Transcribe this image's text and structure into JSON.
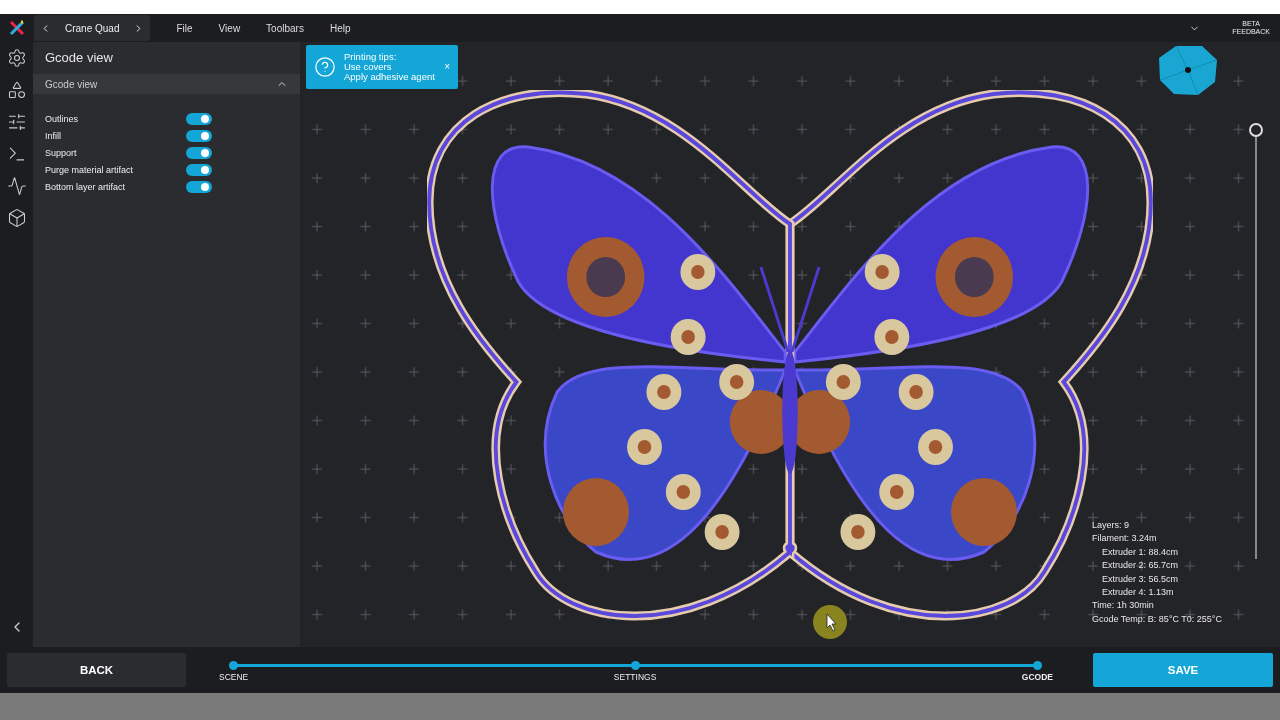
{
  "menubar": {
    "printer": "Crane Quad",
    "menus": [
      "File",
      "View",
      "Toolbars",
      "Help"
    ],
    "beta": "BETA",
    "feedback": "FEEDBACK"
  },
  "panel": {
    "title": "Gcode view",
    "section": {
      "title": "Gcode view",
      "expanded": true,
      "toggles": [
        {
          "label": "Outlines",
          "on": true
        },
        {
          "label": "Infill",
          "on": true
        },
        {
          "label": "Support",
          "on": true
        },
        {
          "label": "Purge material artifact",
          "on": true
        },
        {
          "label": "Bottom layer artifact",
          "on": true
        }
      ]
    }
  },
  "tip": {
    "title": "Printing tips:",
    "lines": [
      "Use covers",
      "Apply adhesive agent"
    ],
    "close": "×"
  },
  "layer_slider": {
    "level": 1
  },
  "stats": [
    {
      "text": "Layers: 9"
    },
    {
      "text": "Filament: 3.24m",
      "children": [
        {
          "text": "Extruder 1: 88.4cm"
        },
        {
          "text": "Extruder 2: 65.7cm"
        },
        {
          "text": "Extruder 3: 56.5cm"
        },
        {
          "text": "Extruder 4: 1.13m"
        }
      ]
    },
    {
      "text": "Time: 1h 30min"
    },
    {
      "text": "Gcode Temp: B: 85°C T0: 255°C"
    }
  ],
  "footer": {
    "back": "BACK",
    "save": "SAVE",
    "steps": [
      {
        "label": "SCENE",
        "selected": false
      },
      {
        "label": "SETTINGS",
        "selected": false
      },
      {
        "label": "GCODE",
        "selected": true
      }
    ]
  }
}
